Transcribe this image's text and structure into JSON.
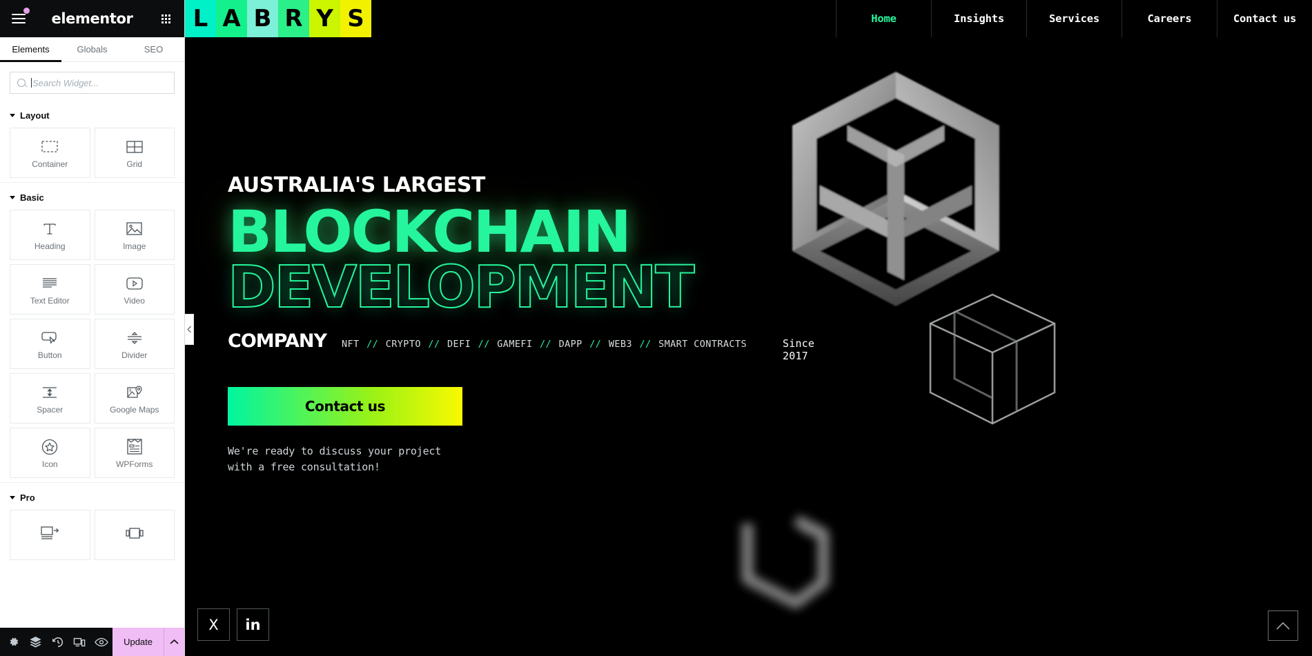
{
  "editor": {
    "app_name": "elementor",
    "menu_icon": "hamburger-icon",
    "apps_icon": "grid-apps-icon",
    "tabs": [
      {
        "label": "Elements",
        "active": true
      },
      {
        "label": "Globals",
        "active": false
      },
      {
        "label": "SEO",
        "active": false
      }
    ],
    "search": {
      "placeholder": "Search Widget...",
      "value": "",
      "icon": "search-icon"
    },
    "sections": [
      {
        "title": "Layout",
        "widgets": [
          {
            "label": "Container",
            "icon": "container-icon"
          },
          {
            "label": "Grid",
            "icon": "grid-icon"
          }
        ]
      },
      {
        "title": "Basic",
        "widgets": [
          {
            "label": "Heading",
            "icon": "heading-t-icon"
          },
          {
            "label": "Image",
            "icon": "image-icon"
          },
          {
            "label": "Text Editor",
            "icon": "text-editor-icon"
          },
          {
            "label": "Video",
            "icon": "video-play-icon"
          },
          {
            "label": "Button",
            "icon": "button-cursor-icon"
          },
          {
            "label": "Divider",
            "icon": "divider-icon"
          },
          {
            "label": "Spacer",
            "icon": "spacer-icon"
          },
          {
            "label": "Google Maps",
            "icon": "google-maps-pin-icon"
          },
          {
            "label": "Icon",
            "icon": "star-circle-icon"
          },
          {
            "label": "WPForms",
            "icon": "wpforms-icon"
          }
        ]
      },
      {
        "title": "Pro",
        "widgets": [
          {
            "label": "",
            "icon": "posts-icon"
          },
          {
            "label": "",
            "icon": "carousel-icon"
          }
        ]
      }
    ],
    "footer": {
      "icons": [
        "settings-gear-icon",
        "navigator-layers-icon",
        "history-revisions-icon",
        "responsive-device-icon",
        "preview-eye-icon"
      ],
      "update_label": "Update",
      "update_caret_icon": "chevron-up-icon",
      "update_color": "#f0bdf5"
    },
    "collapse_handle_icon": "chevron-left-icon"
  },
  "site": {
    "logo": {
      "letters": [
        "L",
        "A",
        "B",
        "R",
        "Y",
        "S"
      ],
      "tile_colors": [
        "#00f0c8",
        "#14f08c",
        "#7df0d8",
        "#2bf08a",
        "#ccf500",
        "#f2f200"
      ]
    },
    "nav": [
      {
        "label": "Home",
        "active": true
      },
      {
        "label": "Insights",
        "active": false
      },
      {
        "label": "Services",
        "active": false
      },
      {
        "label": "Careers",
        "active": false
      },
      {
        "label": "Contact us",
        "active": false
      }
    ],
    "hero": {
      "eyebrow": "AUSTRALIA'S LARGEST",
      "headline_solid": "BLOCKCHAIN",
      "headline_outline": "DEVELOPMENT",
      "company_word": "COMPANY",
      "chips": [
        "NFT",
        "CRYPTO",
        "DEFI",
        "GAMEFI",
        "DAPP",
        "WEB3",
        "SMART CONTRACTS"
      ],
      "chip_separator": "//",
      "since": "Since 2017",
      "cta_label": "Contact us",
      "sub_note_line1": "We're ready to discuss your project",
      "sub_note_line2": "with a free consultation!",
      "accent_green": "#25f59c",
      "accent_yellow": "#f9f900"
    },
    "socials": [
      {
        "label": "X",
        "icon": "x-twitter-icon"
      },
      {
        "label": "in",
        "icon": "linkedin-icon"
      }
    ],
    "to_top_icon": "chevron-up-icon",
    "art": [
      {
        "name": "hollow-cube-3d"
      },
      {
        "name": "wireframe-cube-3d"
      },
      {
        "name": "blurred-glow-shape"
      }
    ]
  }
}
